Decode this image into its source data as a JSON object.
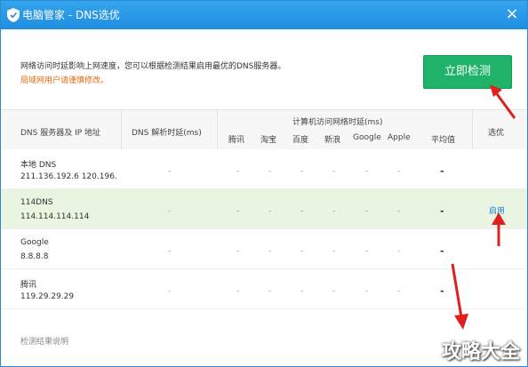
{
  "window": {
    "title": "电脑管家 - DNS选优"
  },
  "info": {
    "description": "网络访问时延影响上网速度，您可以根据检测结果启用最优的DNS服务器。",
    "link": "局域网用户请谨慎修改。",
    "detect_button": "立即检测"
  },
  "table": {
    "headers": {
      "dns": "DNS 服务器及 IP 地址",
      "resolve": "DNS 解析时延(ms)",
      "group": "计算机访问网络时延(ms)",
      "sites": [
        "腾讯",
        "淘宝",
        "百度",
        "新浪",
        "Google",
        "Apple"
      ],
      "avg": "平均值",
      "pick": "选优"
    },
    "rows": [
      {
        "name": "本地 DNS",
        "ip": "211.136.192.6 120.196.",
        "resolve": "-",
        "sites": [
          "-",
          "-",
          "-",
          "-",
          "-",
          "-"
        ],
        "avg": "-"
      },
      {
        "name": "114DNS",
        "ip": "114.114.114.114",
        "resolve": "-",
        "sites": [
          "-",
          "-",
          "-",
          "-",
          "-",
          "-"
        ],
        "avg": "-",
        "action": "启用"
      },
      {
        "name": "Google",
        "ip": "8.8.8.8",
        "resolve": "-",
        "sites": [
          "-",
          "-",
          "-",
          "-",
          "-",
          "-"
        ],
        "avg": "-"
      },
      {
        "name": "腾讯",
        "ip": "119.29.29.29",
        "resolve": "-",
        "sites": [
          "-",
          "-",
          "-",
          "-",
          "-",
          "-"
        ],
        "avg": "-"
      }
    ]
  },
  "footer": {
    "link": "检测结果说明"
  },
  "watermark": "攻略大全",
  "colors": {
    "titlebar": "#1f8ee0",
    "button": "#1fb36a",
    "selected_row": "#e9f4e1",
    "arrow": "#e02020"
  }
}
